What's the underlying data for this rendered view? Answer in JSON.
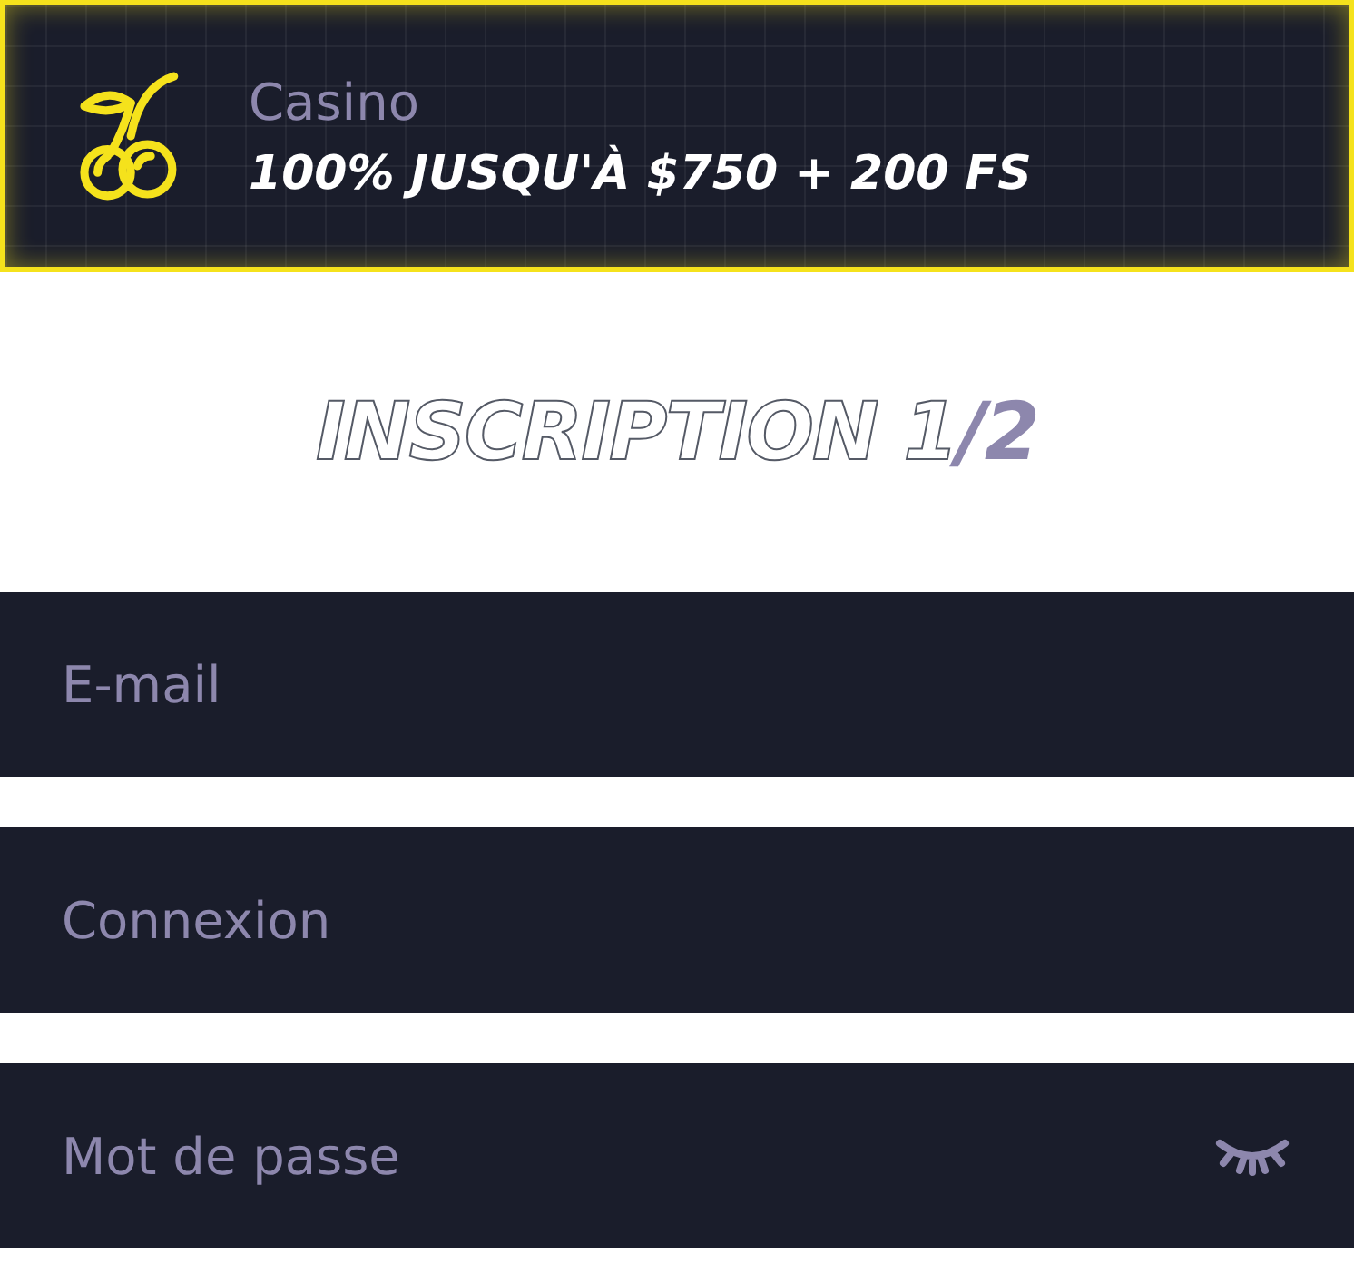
{
  "banner": {
    "category": "Casino",
    "offer": "100% JUSQU'À $750 + 200 FS"
  },
  "title": {
    "text": "INSCRIPTION 1",
    "highlight": "/2"
  },
  "fields": [
    {
      "kind": "text",
      "placeholder": "E-mail"
    },
    {
      "kind": "text",
      "placeholder": "Connexion"
    },
    {
      "kind": "password",
      "placeholder": "Mot de passe"
    }
  ]
}
